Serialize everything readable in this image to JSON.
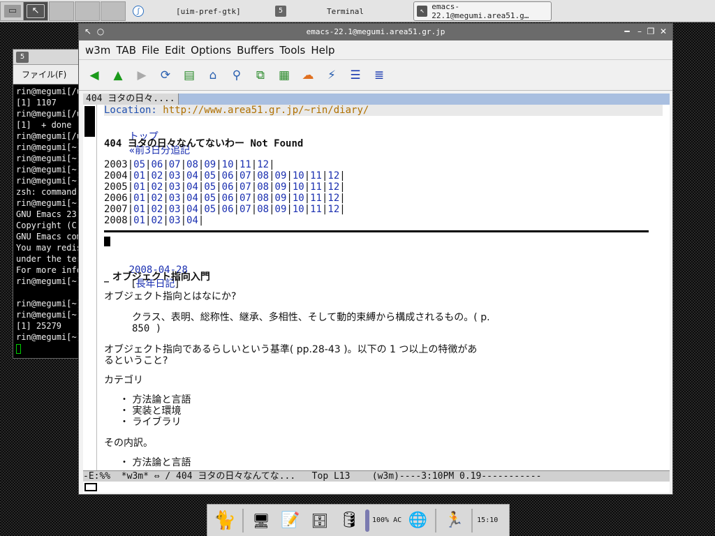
{
  "taskbar": {
    "tasks": [
      {
        "label": "[uim-pref-gtk]"
      },
      {
        "label": "Terminal"
      },
      {
        "label": "emacs-22.1@megumi.area51.g…"
      }
    ]
  },
  "terminal": {
    "menu_label": "ファイル(F)",
    "lines": [
      "rin@megumi[/u",
      "[1] 1107",
      "rin@megumi[/u",
      "[1]  + done",
      "rin@megumi[/u",
      "rin@megumi[~]",
      "rin@megumi[~]",
      "rin@megumi[~]",
      "rin@megumi[~]",
      "zsh: command",
      "rin@megumi[~]",
      "GNU Emacs 23.",
      "Copyright (C)",
      "GNU Emacs com",
      "You may redis",
      "under the ter",
      "For more info",
      "rin@megumi[~]",
      "",
      "rin@megumi[~]",
      "rin@megumi[~]",
      "[1] 25279",
      "rin@megumi[~]"
    ]
  },
  "emacs": {
    "title": "emacs-22.1@megumi.area51.gr.jp",
    "menu": [
      "w3m",
      "TAB",
      "File",
      "Edit",
      "Options",
      "Buffers",
      "Tools",
      "Help"
    ],
    "tab_label": "404 ヨタの日々....",
    "location_label": "Location:",
    "location_url": "http://www.area51.gr.jp/~rin/diary/",
    "nav_links": {
      "top": "トップ",
      "prev": "«前3日分",
      "post": "追記"
    },
    "heading": "404 ヨタの日々なんてないわー Not Found",
    "archive": [
      {
        "year": "2003",
        "months": [
          "05",
          "06",
          "07",
          "08",
          "09",
          "10",
          "11",
          "12"
        ]
      },
      {
        "year": "2004",
        "months": [
          "01",
          "02",
          "03",
          "04",
          "05",
          "06",
          "07",
          "08",
          "09",
          "10",
          "11",
          "12"
        ]
      },
      {
        "year": "2005",
        "months": [
          "01",
          "02",
          "03",
          "04",
          "05",
          "06",
          "07",
          "08",
          "09",
          "10",
          "11",
          "12"
        ]
      },
      {
        "year": "2006",
        "months": [
          "01",
          "02",
          "03",
          "04",
          "05",
          "06",
          "07",
          "08",
          "09",
          "10",
          "11",
          "12"
        ]
      },
      {
        "year": "2007",
        "months": [
          "01",
          "02",
          "03",
          "04",
          "05",
          "06",
          "07",
          "08",
          "09",
          "10",
          "11",
          "12"
        ]
      },
      {
        "year": "2008",
        "months": [
          "01",
          "02",
          "03",
          "04"
        ]
      }
    ],
    "entry_date": "2008-04-28",
    "entry_category": "長年日記",
    "section_title": "オブジェクト指向入門",
    "q1": "オブジェクト指向とはなにか?",
    "quote_line1": "クラス、表明、総称性、継承、多相性、そして動的束縛から構成されるもの。( p.",
    "quote_line2": "850 )",
    "p2_line1": "オブジェクト指向であるらしいという基準( pp.28-43 )。以下の 1 つ以上の特徴があ",
    "p2_line2": "るということ?",
    "category_label": "カテゴリ",
    "categories": [
      "方法論と言語",
      "実装と環境",
      "ライブラリ"
    ],
    "breakdown_label": "その内訳。",
    "breakdown_first": "方法論と言語",
    "modeline": "-E:%%  *w3m* ⇔ / 404 ヨタの日々なんてな...   Top L13    (w3m)----3:10PM 0.19-----------"
  },
  "dock": {
    "battery": "100% AC",
    "clock": "15:10"
  },
  "icons": {
    "toolbar": [
      "back-arrow-icon",
      "up-arrow-icon",
      "forward-arrow-icon",
      "reload-icon",
      "bookmark-add-icon",
      "home-icon",
      "search-icon",
      "copy-icon",
      "paste-icon",
      "weather-icon",
      "antenna-icon",
      "list-icon",
      "db-icon"
    ]
  }
}
